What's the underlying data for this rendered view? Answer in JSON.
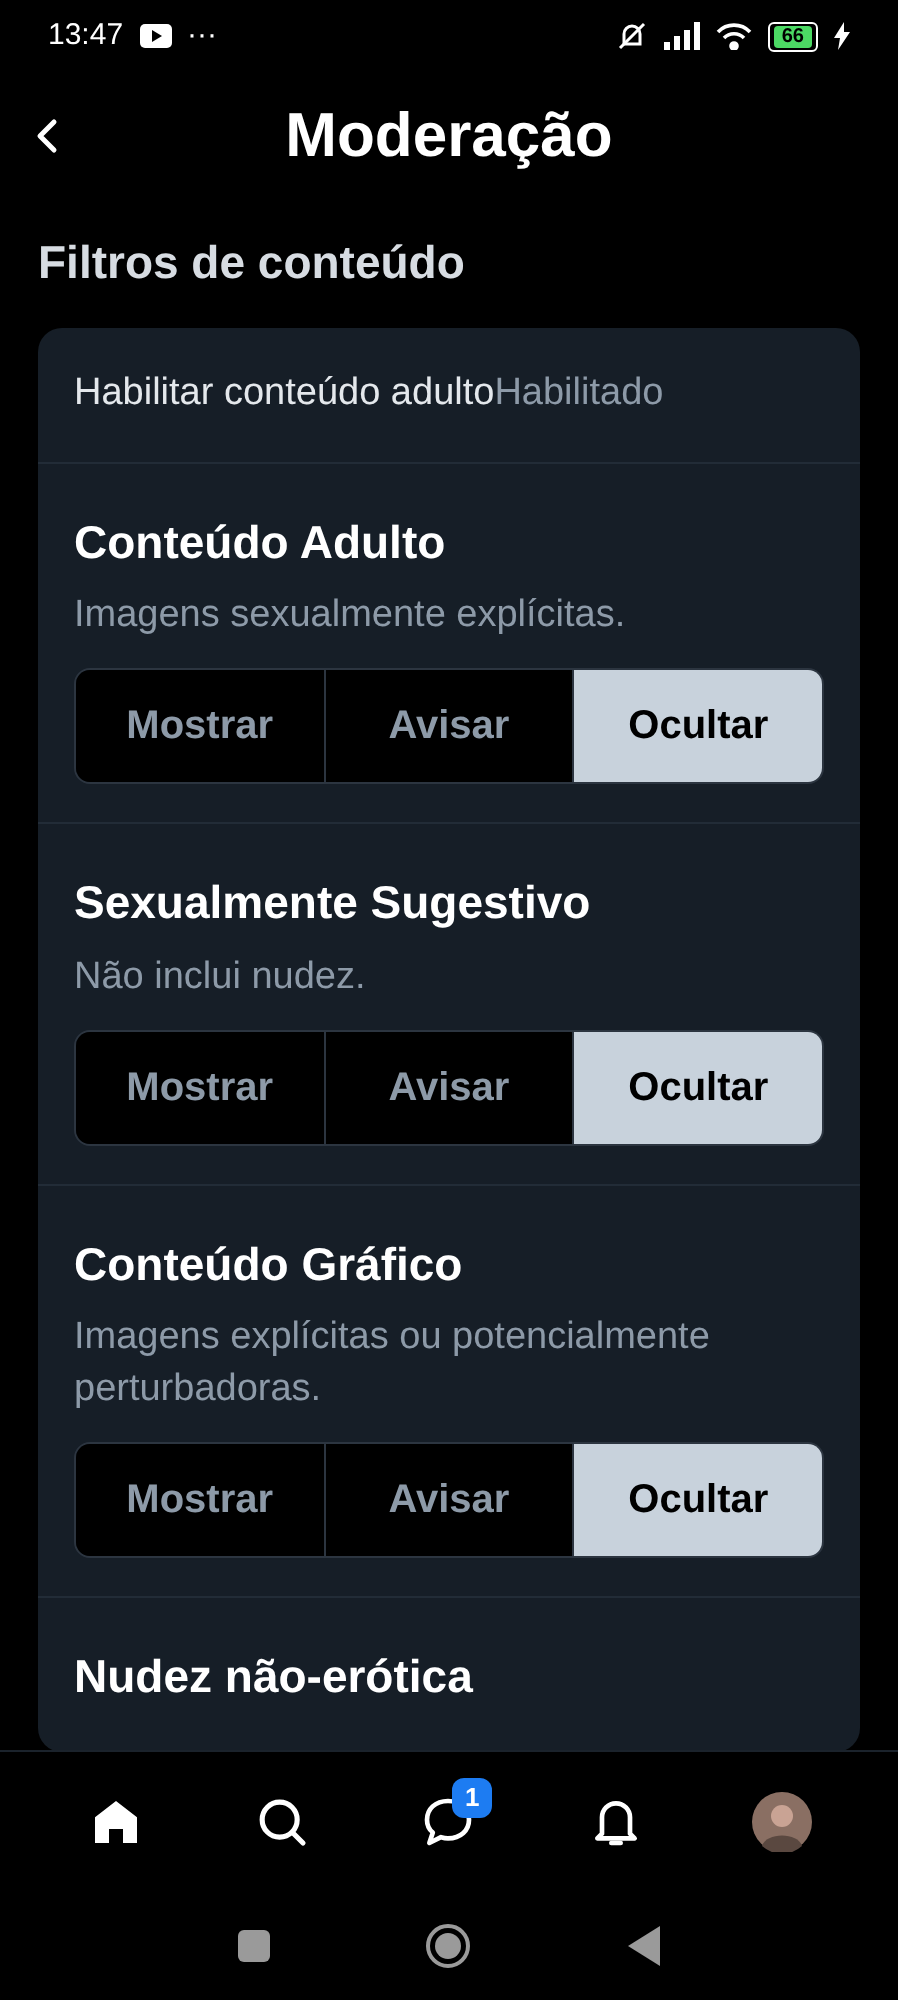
{
  "status_bar": {
    "time": "13:47",
    "more": "···",
    "battery": "66"
  },
  "header": {
    "title": "Moderação"
  },
  "section_title": "Filtros de conteúdo",
  "adult_toggle": {
    "label": "Habilitar conteúdo adulto",
    "value": "Habilitado"
  },
  "filters": [
    {
      "title": "Conteúdo Adulto",
      "description": "Imagens sexualmente explícitas.",
      "options": [
        {
          "label": "Mostrar",
          "selected": false
        },
        {
          "label": "Avisar",
          "selected": false
        },
        {
          "label": "Ocultar",
          "selected": true
        }
      ]
    },
    {
      "title": "Sexualmente Sugestivo",
      "description": "Não inclui nudez.",
      "options": [
        {
          "label": "Mostrar",
          "selected": false
        },
        {
          "label": "Avisar",
          "selected": false
        },
        {
          "label": "Ocultar",
          "selected": true
        }
      ]
    },
    {
      "title": "Conteúdo Gráfico",
      "description": "Imagens explícitas ou potencialmente perturbadoras.",
      "options": [
        {
          "label": "Mostrar",
          "selected": false
        },
        {
          "label": "Avisar",
          "selected": false
        },
        {
          "label": "Ocultar",
          "selected": true
        }
      ]
    },
    {
      "title": "Nudez não-erótica"
    }
  ],
  "tab_bar": {
    "items": [
      {
        "kind": "home"
      },
      {
        "kind": "search"
      },
      {
        "kind": "chat",
        "badge": "1"
      },
      {
        "kind": "bell"
      },
      {
        "kind": "avatar"
      }
    ]
  }
}
